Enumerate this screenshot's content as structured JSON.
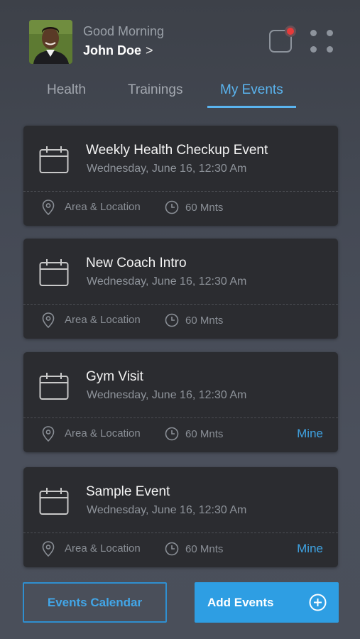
{
  "header": {
    "greeting": "Good Morning",
    "user_name": "John Doe",
    "chevron": ">",
    "has_notification": true
  },
  "tabs": [
    {
      "label": "Health",
      "active": false
    },
    {
      "label": "Trainings",
      "active": false
    },
    {
      "label": "My Events",
      "active": true
    }
  ],
  "events": [
    {
      "title": "Weekly Health Checkup Event",
      "date": "Wednesday, June 16, 12:30 Am",
      "location": "Area & Location",
      "duration": "60 Mnts",
      "tag": ""
    },
    {
      "title": "New Coach Intro",
      "date": "Wednesday, June 16, 12:30 Am",
      "location": "Area & Location",
      "duration": "60 Mnts",
      "tag": ""
    },
    {
      "title": "Gym Visit",
      "date": "Wednesday, June 16, 12:30 Am",
      "location": "Area & Location",
      "duration": "60 Mnts",
      "tag": "Mine"
    },
    {
      "title": "Sample Event",
      "date": "Wednesday, June 16, 12:30 Am",
      "location": "Area & Location",
      "duration": "60 Mnts",
      "tag": "Mine"
    }
  ],
  "footer": {
    "calendar_label": "Events Calendar",
    "add_label": "Add Events"
  },
  "colors": {
    "accent": "#2e9ee3",
    "card": "#2b2c30",
    "notification": "#e83a3a"
  },
  "icons": [
    "bell-icon",
    "more-dots-icon",
    "calendar-icon",
    "location-pin-icon",
    "clock-icon",
    "plus-circle-icon"
  ]
}
